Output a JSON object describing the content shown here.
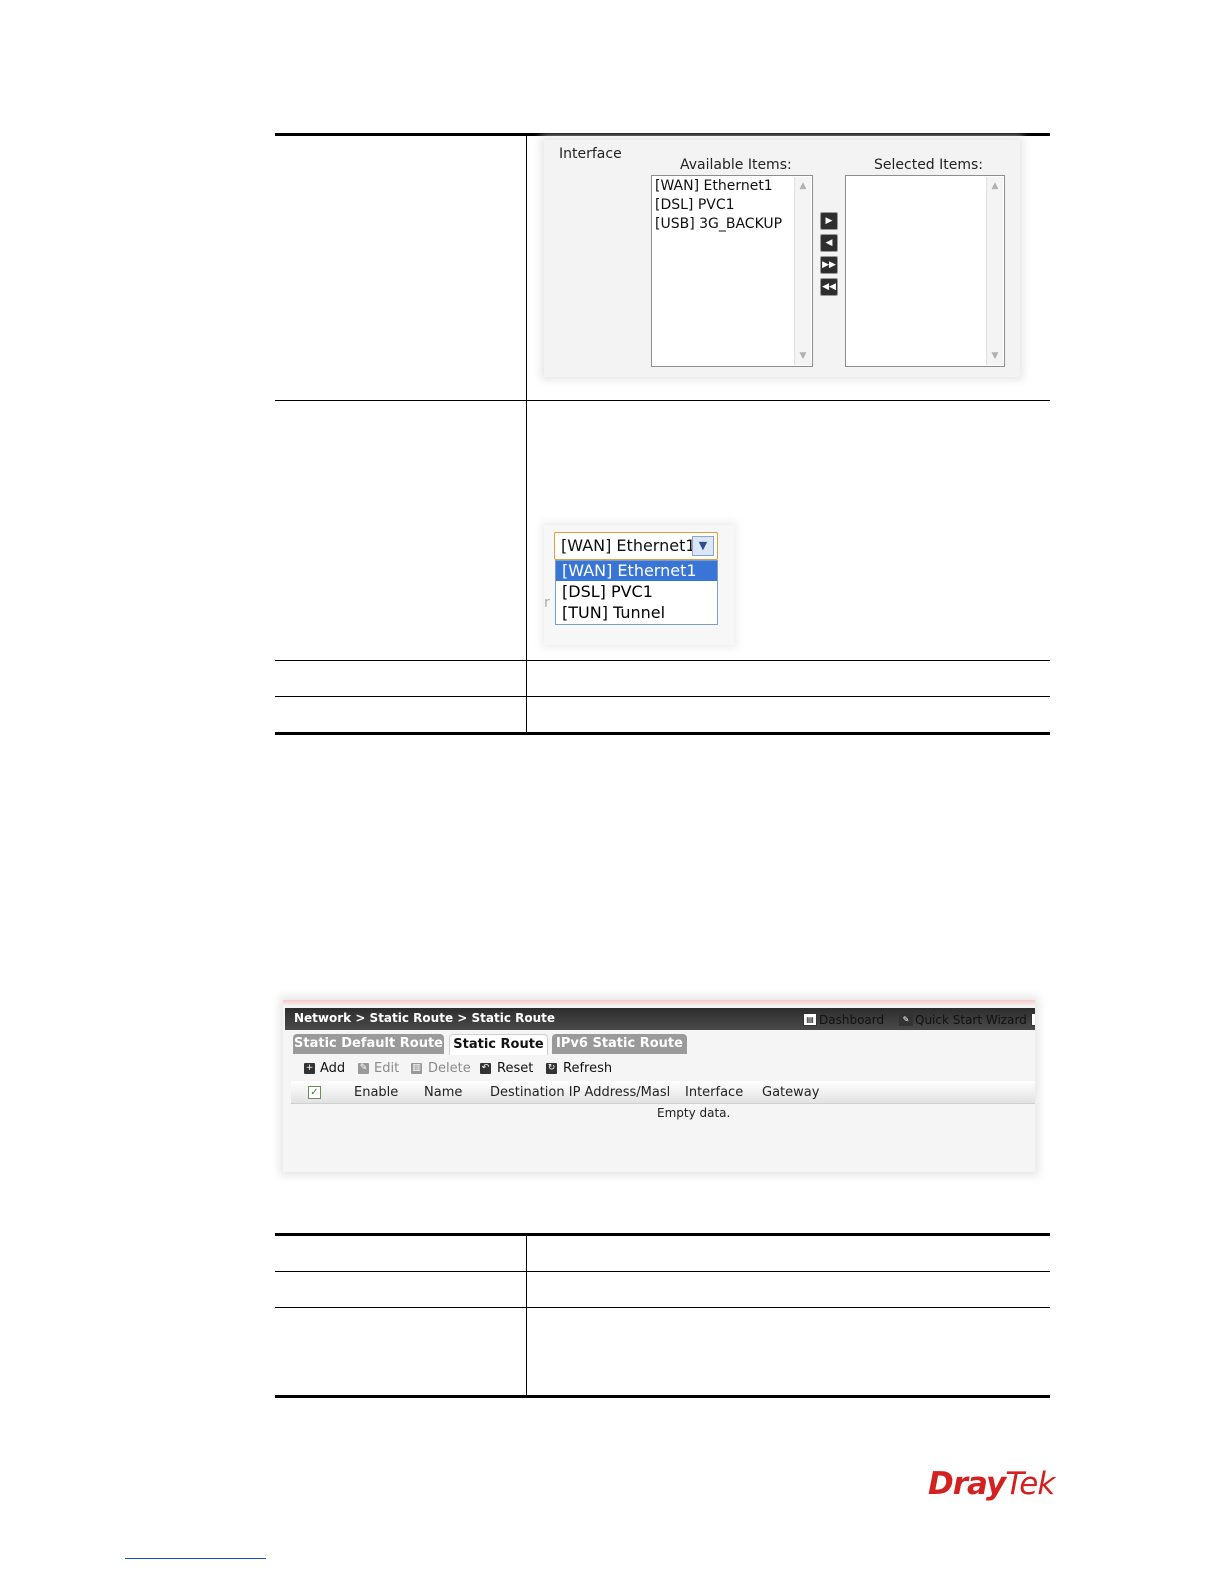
{
  "interface_picker": {
    "label": "Interface",
    "available_title": "Available Items:",
    "selected_title": "Selected Items:",
    "available_items": [
      "[WAN] Ethernet1",
      "[DSL] PVC1",
      "[USB] 3G_BACKUP"
    ],
    "selected_items": [],
    "move_buttons": [
      "move-right",
      "move-left",
      "move-all-right",
      "move-all-left"
    ]
  },
  "interface_dropdown": {
    "selected_value": "[WAN] Ethernet1",
    "options": [
      "[WAN] Ethernet1",
      "[DSL] PVC1",
      "[TUN] Tunnel"
    ],
    "partial_text": "r"
  },
  "router_ui": {
    "breadcrumb": "Network > Static Route > Static Route",
    "header_links": [
      "Dashboard",
      "Quick Start Wizard"
    ],
    "tabs": [
      "Static Default Route",
      "Static Route",
      "IPv6 Static Route"
    ],
    "active_tab": "Static Route",
    "toolbar": {
      "add": "Add",
      "edit": "Edit",
      "delete": "Delete",
      "reset": "Reset",
      "refresh": "Refresh"
    },
    "columns": [
      "Enable",
      "Name",
      "Destination IP Address/Masl",
      "Interface",
      "Gateway"
    ],
    "empty_message": "Empty data."
  },
  "footer": {
    "logo_text_a": "Dray",
    "logo_text_b": "Tek",
    "brand_color": "#d32020"
  }
}
